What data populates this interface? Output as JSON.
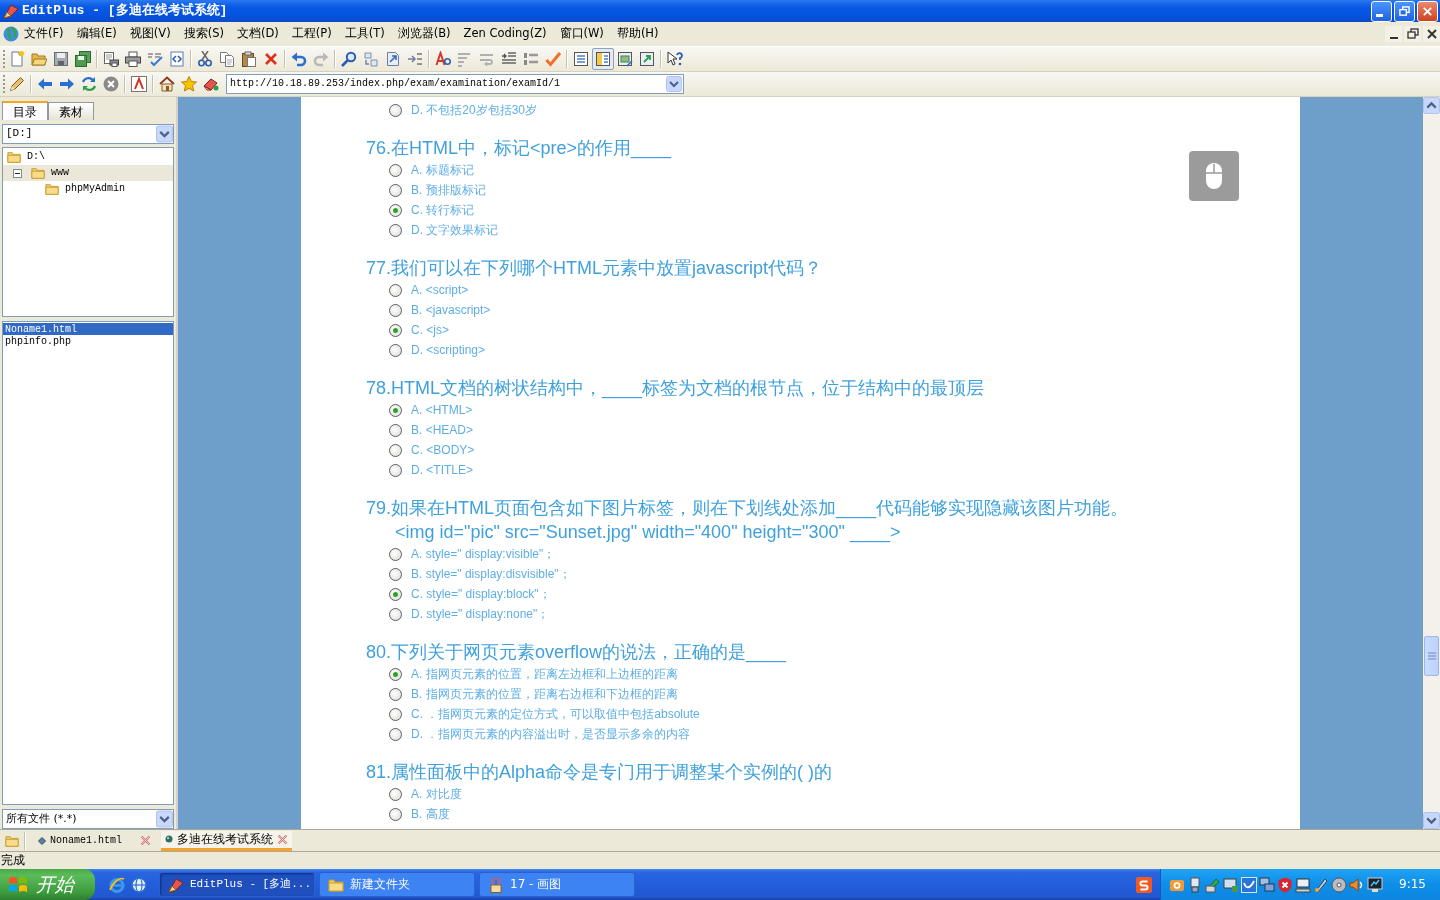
{
  "window": {
    "title": "EditPlus - [多迪在线考试系统]"
  },
  "menu": [
    "文件(F)",
    "编辑(E)",
    "视图(V)",
    "搜索(S)",
    "文档(D)",
    "工程(P)",
    "工具(T)",
    "浏览器(B)",
    "Zen Coding(Z)",
    "窗口(W)",
    "帮助(H)"
  ],
  "view_buttons": [
    {
      "pressed": false
    },
    {
      "pressed": true
    },
    {
      "pressed": false
    },
    {
      "pressed": false
    }
  ],
  "address_bar": {
    "value": "http://10.18.89.253/index.php/exam/examination/examId/1"
  },
  "sidebar": {
    "tabs": [
      {
        "label": "目录",
        "selected": true
      },
      {
        "label": "素材",
        "selected": false
      }
    ],
    "drive": "[D:]",
    "tree": [
      {
        "label": "D:\\",
        "selected": false,
        "children": [
          {
            "label": "www",
            "selected": true,
            "expanded": true,
            "children": [
              {
                "label": "phpMyAdmin",
                "selected": false
              }
            ]
          }
        ]
      }
    ],
    "files": [
      {
        "name": "Noname1.html",
        "selected": true
      },
      {
        "name": "phpinfo.php",
        "selected": false
      }
    ],
    "filter": "所有文件 (*.*)"
  },
  "exam": {
    "questions": [
      {
        "options": [
          {
            "label": "D. 不包括20岁包括30岁",
            "selected": false
          }
        ]
      },
      {
        "title": "76.在HTML中，标记<pre>的作用____",
        "options": [
          {
            "label": "A. 标题标记",
            "selected": false
          },
          {
            "label": "B. 预排版标记",
            "selected": false
          },
          {
            "label": "C. 转行标记",
            "selected": true
          },
          {
            "label": "D. 文字效果标记",
            "selected": false
          }
        ]
      },
      {
        "title": "77.我们可以在下列哪个HTML元素中放置javascript代码？",
        "options": [
          {
            "label": "A. <script>",
            "selected": false
          },
          {
            "label": "B. <javascript>",
            "selected": false
          },
          {
            "label": "C. <js>",
            "selected": true
          },
          {
            "label": "D. <scripting>",
            "selected": false
          }
        ]
      },
      {
        "title": "78.HTML文档的树状结构中，____标签为文档的根节点，位于结构中的最顶层",
        "options": [
          {
            "label": "A. <HTML>",
            "selected": true
          },
          {
            "label": "B. <HEAD>",
            "selected": false
          },
          {
            "label": "C. <BODY>",
            "selected": false
          },
          {
            "label": "D. <TITLE>",
            "selected": false
          }
        ]
      },
      {
        "title": "79.如果在HTML页面包含如下图片标签，则在下划线处添加____代码能够实现隐藏该图片功能。",
        "code": "<img id=\"pic\" src=\"Sunset.jpg\" width=\"400\" height=\"300\" ____>",
        "options": [
          {
            "label": "A. style=\" display:visible\"；",
            "selected": false
          },
          {
            "label": "B. style=\" display:disvisible\"；",
            "selected": false
          },
          {
            "label": "C. style=\" display:block\"；",
            "selected": true
          },
          {
            "label": "D. style=\" display:none\"；",
            "selected": false
          }
        ]
      },
      {
        "title": "80.下列关于网页元素overflow的说法，正确的是____",
        "options": [
          {
            "label": "A. 指网页元素的位置，距离左边框和上边框的距离",
            "selected": true
          },
          {
            "label": "B. 指网页元素的位置，距离右边框和下边框的距离",
            "selected": false
          },
          {
            "label": "C. ．指网页元素的定位方式，可以取值中包括absolute",
            "selected": false
          },
          {
            "label": "D. ．指网页元素的内容溢出时，是否显示多余的内容",
            "selected": false
          }
        ]
      },
      {
        "title": "81.属性面板中的Alpha命令是专门用于调整某个实例的( )的",
        "options": [
          {
            "label": "A. 对比度",
            "selected": false
          },
          {
            "label": "B. 高度",
            "selected": false
          }
        ]
      }
    ]
  },
  "document_tabs": [
    {
      "label": "Noname1.html",
      "kind": "file",
      "selected": false
    },
    {
      "label": "多迪在线考试系统",
      "kind": "browser",
      "selected": true
    }
  ],
  "status_bar": {
    "text": "完成"
  },
  "taskbar": {
    "start": "开始",
    "tasks": [
      {
        "label": "EditPlus - [多迪...",
        "kind": "editplus",
        "selected": true
      },
      {
        "label": "新建文件夹",
        "kind": "folder",
        "selected": false
      },
      {
        "label": "17 - 画图",
        "kind": "paint",
        "selected": false
      }
    ],
    "clock": "9:15"
  }
}
